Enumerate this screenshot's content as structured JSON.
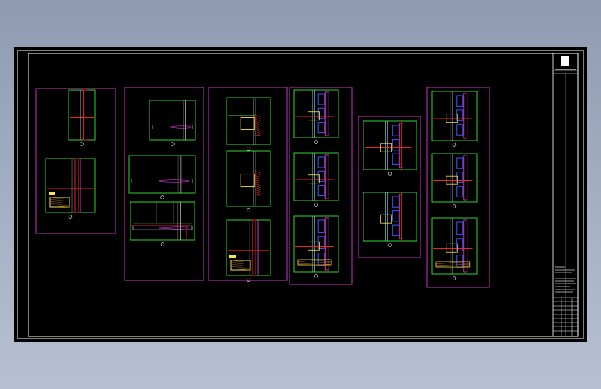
{
  "canvas": {
    "background": "#000000",
    "outside_background": "#9aa6ba"
  },
  "colors": {
    "frame": "#ffffff",
    "group_border": "#cc33cc",
    "detail_border": "#33ee33",
    "wall_line": "#ee2222",
    "insulation": "#cc33cc",
    "glass": "#33cccc",
    "panel": "#3355ee",
    "dimension": "#44dd44",
    "tag_fill": "#ffe14a",
    "title_text": "#cfcfcf"
  },
  "drawing": {
    "description_blocks": 4,
    "title_block_rows": 12
  },
  "groups": [
    {
      "id": "group-1",
      "details": 2
    },
    {
      "id": "group-2",
      "details": 3
    },
    {
      "id": "group-3",
      "details": 3
    },
    {
      "id": "group-4",
      "details": 3
    },
    {
      "id": "group-5",
      "details": 2
    },
    {
      "id": "group-6",
      "details": 3
    }
  ]
}
